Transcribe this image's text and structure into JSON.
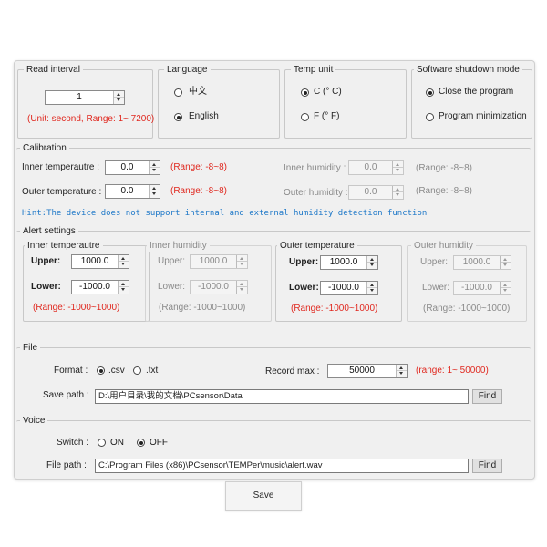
{
  "read_interval": {
    "title": "Read interval",
    "value": "1",
    "note": "(Unit: second, Range: 1~ 7200)"
  },
  "language": {
    "title": "Language",
    "options": [
      "中文",
      "English"
    ],
    "selected": 1
  },
  "temp_unit": {
    "title": "Temp unit",
    "options": [
      "C (° C)",
      "F (° F)"
    ],
    "selected": 0
  },
  "shutdown": {
    "title": "Software shutdown mode",
    "options": [
      "Close the program",
      "Program minimization"
    ],
    "selected": 0
  },
  "calibration": {
    "title": "Calibration",
    "inner_temp_label": "Inner temperautre :",
    "inner_temp_value": "0.0",
    "outer_temp_label": "Outer temperature :",
    "outer_temp_value": "0.0",
    "temp_range": "(Range: -8~8)",
    "inner_hum_label": "Inner humidity :",
    "inner_hum_value": "0.0",
    "outer_hum_label": "Outer humidity :",
    "outer_hum_value": "0.0",
    "hum_range": "(Range: -8~8)",
    "hint": "Hint:The device does not support internal and external humidity detection function"
  },
  "alert": {
    "title": "Alert settings",
    "groups": [
      {
        "title": "Inner temperautre",
        "upper_label": "Upper:",
        "upper": "1000.0",
        "lower_label": "Lower:",
        "lower": "-1000.0",
        "range": "(Range: -1000~1000)"
      },
      {
        "title": "Inner humidity",
        "upper_label": "Upper:",
        "upper": "1000.0",
        "lower_label": "Lower:",
        "lower": "-1000.0",
        "range": "(Range: -1000~1000)"
      },
      {
        "title": "Outer temperature",
        "upper_label": "Upper:",
        "upper": "1000.0",
        "lower_label": "Lower:",
        "lower": "-1000.0",
        "range": "(Range: -1000~1000)"
      },
      {
        "title": "Outer humidity",
        "upper_label": "Upper:",
        "upper": "1000.0",
        "lower_label": "Lower:",
        "lower": "-1000.0",
        "range": "(Range: -1000~1000)"
      }
    ]
  },
  "file": {
    "title": "File",
    "format_label": "Format :",
    "format_options": [
      ".csv",
      ".txt"
    ],
    "format_selected": 0,
    "record_label": "Record max :",
    "record_value": "50000",
    "record_range": "(range: 1~ 50000)",
    "path_label": "Save path :",
    "path_value": "D:\\用户目录\\我的文档\\PCsensor\\Data",
    "find_label": "Find"
  },
  "voice": {
    "title": "Voice",
    "switch_label": "Switch :",
    "switch_options": [
      "ON",
      "OFF"
    ],
    "switch_selected": 1,
    "path_label": "File path :",
    "path_value": "C:\\Program Files (x86)\\PCsensor\\TEMPer\\music\\alert.wav",
    "find_label": "Find"
  },
  "save_label": "Save",
  "colors": {
    "accent_red": "#e0281f",
    "hint_blue": "#1e78c8",
    "disabled_gray": "#8a8a8a"
  }
}
